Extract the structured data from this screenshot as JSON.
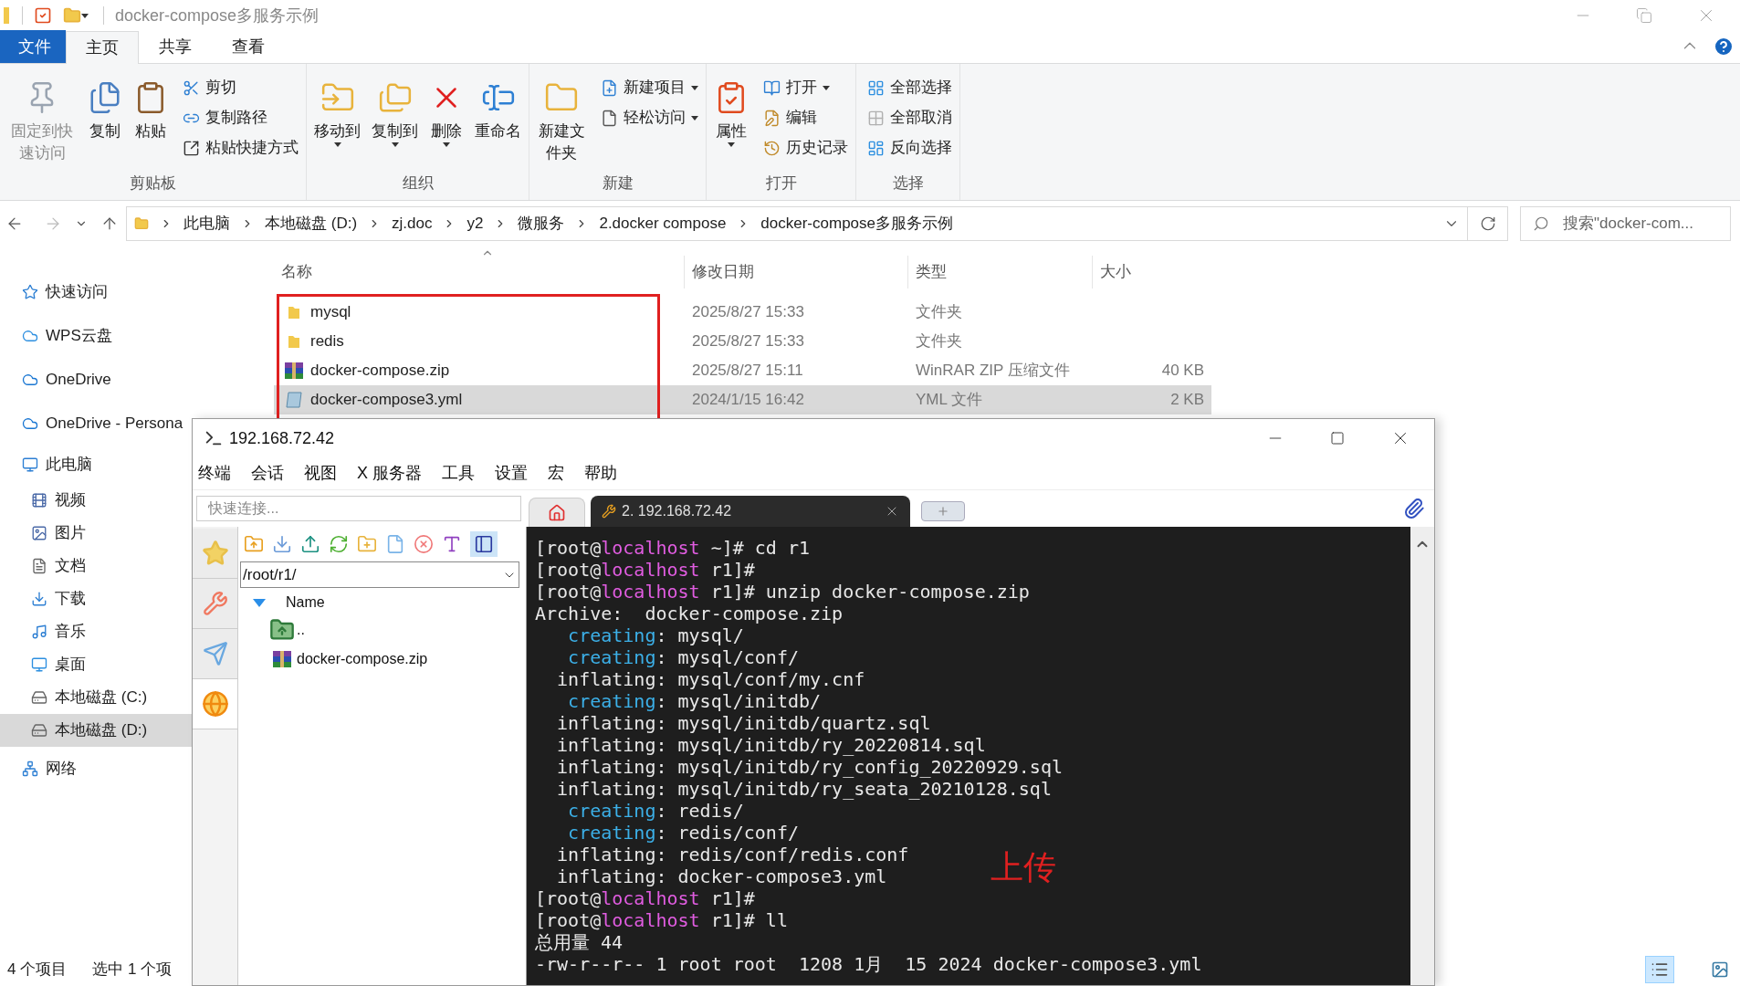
{
  "explorer": {
    "title": "docker-compose多服务示例",
    "ribbon_tabs": [
      {
        "label": "文件",
        "kind": "file"
      },
      {
        "label": "主页",
        "kind": "tab",
        "selected": true
      },
      {
        "label": "共享",
        "kind": "tab",
        "selected": false
      },
      {
        "label": "查看",
        "kind": "tab",
        "selected": false
      }
    ],
    "ribbon_groups": [
      {
        "label": "剪贴板",
        "large": [
          {
            "label": "固定到快速访问",
            "disabled": true,
            "menu": false
          },
          {
            "label": "复制",
            "disabled": false,
            "menu": false
          },
          {
            "label": "粘贴",
            "disabled": false,
            "menu": false
          }
        ],
        "small": [
          {
            "label": "剪切",
            "menu": false
          },
          {
            "label": "复制路径",
            "menu": false
          },
          {
            "label": "粘贴快捷方式",
            "menu": false
          }
        ]
      },
      {
        "label": "组织",
        "large": [
          {
            "label": "移动到",
            "disabled": false,
            "menu": true
          },
          {
            "label": "复制到",
            "disabled": false,
            "menu": true
          },
          {
            "label": "删除",
            "disabled": false,
            "menu": true
          },
          {
            "label": "重命名",
            "disabled": false,
            "menu": false
          }
        ]
      },
      {
        "label": "新建",
        "large": [
          {
            "label": "新建文件夹",
            "disabled": false,
            "menu": false
          }
        ],
        "small": [
          {
            "label": "新建项目",
            "menu": true
          },
          {
            "label": "轻松访问",
            "menu": true
          }
        ]
      },
      {
        "label": "打开",
        "large": [
          {
            "label": "属性",
            "disabled": false,
            "menu": true
          }
        ],
        "small": [
          {
            "label": "打开",
            "menu": true
          },
          {
            "label": "编辑",
            "menu": false
          },
          {
            "label": "历史记录",
            "menu": false
          }
        ]
      },
      {
        "label": "选择",
        "small": [
          {
            "label": "全部选择",
            "menu": false
          },
          {
            "label": "全部取消",
            "menu": false
          },
          {
            "label": "反向选择",
            "menu": false
          }
        ]
      }
    ],
    "breadcrumbs": [
      "此电脑",
      "本地磁盘 (D:)",
      "zj.doc",
      "y2",
      "微服务",
      "2.docker compose",
      "docker-compose多服务示例"
    ],
    "search": {
      "placeholder": "搜索\"docker-com..."
    },
    "sidebar": [
      {
        "label": "快速访问",
        "selected": false
      },
      {
        "label": "WPS云盘",
        "selected": false
      },
      {
        "label": "OneDrive",
        "selected": false
      },
      {
        "label": "OneDrive - Persona",
        "selected": false
      },
      {
        "label": "此电脑",
        "selected": false,
        "children": [
          {
            "label": "视频",
            "selected": false
          },
          {
            "label": "图片",
            "selected": false
          },
          {
            "label": "文档",
            "selected": false
          },
          {
            "label": "下载",
            "selected": false
          },
          {
            "label": "音乐",
            "selected": false
          },
          {
            "label": "桌面",
            "selected": false
          },
          {
            "label": "本地磁盘 (C:)",
            "selected": false
          },
          {
            "label": "本地磁盘 (D:)",
            "selected": true
          }
        ]
      },
      {
        "label": "网络",
        "selected": false
      }
    ],
    "columns": [
      "名称",
      "修改日期",
      "类型",
      "大小"
    ],
    "files": [
      {
        "name": "mysql",
        "kind": "folder",
        "date": "2025/8/27 15:33",
        "type": "文件夹",
        "selected": false
      },
      {
        "name": "redis",
        "kind": "folder",
        "date": "2025/8/27 15:33",
        "type": "文件夹",
        "selected": false
      },
      {
        "name": "docker-compose.zip",
        "kind": "zip",
        "date": "2025/8/27 15:11",
        "type": "WinRAR ZIP 压缩文件",
        "size": "40 KB",
        "selected": false
      },
      {
        "name": "docker-compose3.yml",
        "kind": "yml",
        "date": "2024/1/15 16:42",
        "type": "YML 文件",
        "size": "2 KB",
        "selected": true
      }
    ],
    "status": [
      "4 个项目",
      "选中 1 个项"
    ],
    "views": [
      {
        "kind": "details",
        "selected": true
      },
      {
        "kind": "thumbnails",
        "selected": false
      }
    ]
  },
  "terminal_app": {
    "title": "192.168.72.42",
    "menu": [
      "终端",
      "会话",
      "视图",
      "X 服务器",
      "工具",
      "设置",
      "宏",
      "帮助"
    ],
    "quick_connect": {
      "placeholder": "快速连接..."
    },
    "tabs": [
      {
        "kind": "home",
        "selected": false
      },
      {
        "kind": "session",
        "label": "2. 192.168.72.42",
        "selected": true
      },
      {
        "kind": "new",
        "selected": false
      }
    ],
    "side_tabs": [
      {
        "kind": "star",
        "selected": false
      },
      {
        "kind": "tools",
        "selected": false
      },
      {
        "kind": "send",
        "selected": false
      },
      {
        "kind": "globe",
        "selected": true
      }
    ],
    "path": "/root/r1/",
    "tree_header": "Name",
    "tree": [
      {
        "name": "..",
        "kind": "up"
      },
      {
        "name": "docker-compose.zip",
        "kind": "zip"
      }
    ],
    "lines": [
      [
        {
          "text": "[root@",
          "kind": "plain"
        },
        {
          "text": "localhost",
          "kind": "host"
        },
        {
          "text": " ~]# cd r1",
          "kind": "plain"
        }
      ],
      [
        {
          "text": "[root@",
          "kind": "plain"
        },
        {
          "text": "localhost",
          "kind": "host"
        },
        {
          "text": " r1]#",
          "kind": "plain"
        }
      ],
      [
        {
          "text": "[root@",
          "kind": "plain"
        },
        {
          "text": "localhost",
          "kind": "host"
        },
        {
          "text": " r1]# unzip docker-compose.zip",
          "kind": "plain"
        }
      ],
      [
        {
          "text": "Archive:  docker-compose.zip",
          "kind": "plain"
        }
      ],
      [
        {
          "text": "   creating",
          "kind": "creating"
        },
        {
          "text": ": mysql/",
          "kind": "plain"
        }
      ],
      [
        {
          "text": "   creating",
          "kind": "creating"
        },
        {
          "text": ": mysql/conf/",
          "kind": "plain"
        }
      ],
      [
        {
          "text": "  inflating: mysql/conf/my.cnf",
          "kind": "plain"
        }
      ],
      [
        {
          "text": "   creating",
          "kind": "creating"
        },
        {
          "text": ": mysql/initdb/",
          "kind": "plain"
        }
      ],
      [
        {
          "text": "  inflating: mysql/initdb/quartz.sql",
          "kind": "plain"
        }
      ],
      [
        {
          "text": "  inflating: mysql/initdb/ry_20220814.sql",
          "kind": "plain"
        }
      ],
      [
        {
          "text": "  inflating: mysql/initdb/ry_config_20220929.sql",
          "kind": "plain"
        }
      ],
      [
        {
          "text": "  inflating: mysql/initdb/ry_seata_20210128.sql",
          "kind": "plain"
        }
      ],
      [
        {
          "text": "   creating",
          "kind": "creating"
        },
        {
          "text": ": redis/",
          "kind": "plain"
        }
      ],
      [
        {
          "text": "   creating",
          "kind": "creating"
        },
        {
          "text": ": redis/conf/",
          "kind": "plain"
        }
      ],
      [
        {
          "text": "  inflating: redis/conf/redis.conf",
          "kind": "plain"
        }
      ],
      [
        {
          "text": "  inflating: docker-compose3.yml",
          "kind": "plain"
        }
      ],
      [
        {
          "text": "[root@",
          "kind": "plain"
        },
        {
          "text": "localhost",
          "kind": "host"
        },
        {
          "text": " r1]#",
          "kind": "plain"
        }
      ],
      [
        {
          "text": "[root@",
          "kind": "plain"
        },
        {
          "text": "localhost",
          "kind": "host"
        },
        {
          "text": " r1]# ll",
          "kind": "plain"
        }
      ],
      [
        {
          "text": "总用量 44",
          "kind": "plain"
        }
      ],
      [
        {
          "text": "-rw-r--r-- 1 root root  1208 1月  15 2024 docker-compose3.yml",
          "kind": "plain"
        }
      ]
    ],
    "annotation": "上传"
  }
}
